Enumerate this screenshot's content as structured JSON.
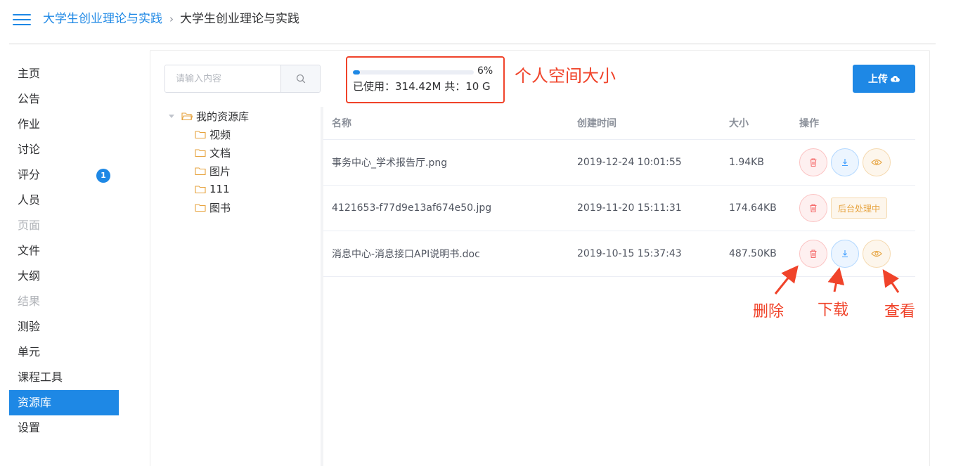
{
  "header": {
    "breadcrumb_link": "大学生创业理论与实践",
    "breadcrumb_separator": "›",
    "breadcrumb_current": "大学生创业理论与实践"
  },
  "sidebar": {
    "items": [
      {
        "label": "主页",
        "state": "normal"
      },
      {
        "label": "公告",
        "state": "normal"
      },
      {
        "label": "作业",
        "state": "normal"
      },
      {
        "label": "讨论",
        "state": "normal"
      },
      {
        "label": "评分",
        "state": "normal",
        "badge": "1"
      },
      {
        "label": "人员",
        "state": "normal"
      },
      {
        "label": "页面",
        "state": "disabled"
      },
      {
        "label": "文件",
        "state": "normal"
      },
      {
        "label": "大纲",
        "state": "normal"
      },
      {
        "label": "结果",
        "state": "disabled"
      },
      {
        "label": "测验",
        "state": "normal"
      },
      {
        "label": "单元",
        "state": "normal"
      },
      {
        "label": "课程工具",
        "state": "normal"
      },
      {
        "label": "资源库",
        "state": "active"
      },
      {
        "label": "设置",
        "state": "normal"
      }
    ]
  },
  "search": {
    "placeholder": "请输入内容",
    "icon": "search-icon"
  },
  "storage": {
    "percent_label": "6%",
    "percent_value": 6,
    "usage_text": "已使用：314.42M 共：10 G",
    "annotation": "个人空间大小"
  },
  "upload": {
    "label": "上传",
    "icon": "cloud-upload-icon"
  },
  "tree": {
    "root": "我的资源库",
    "children": [
      "视频",
      "文档",
      "图片",
      "111",
      "图书"
    ]
  },
  "table": {
    "columns": [
      "名称",
      "创建时间",
      "大小",
      "操作"
    ],
    "rows": [
      {
        "name": "事务中心_学术报告厅.png",
        "created": "2019-12-24 10:01:55",
        "size": "1.94KB",
        "status": ""
      },
      {
        "name": "4121653-f77d9e13af674e50.jpg",
        "created": "2019-11-20 15:11:31",
        "size": "174.64KB",
        "status": "后台处理中"
      },
      {
        "name": "消息中心-消息接口API说明书.doc",
        "created": "2019-10-15 15:37:43",
        "size": "487.50KB",
        "status": ""
      }
    ]
  },
  "annotations": {
    "delete": "删除",
    "download": "下载",
    "view": "查看"
  },
  "colors": {
    "accent": "#1e88e5",
    "annotation_red": "#f0432a",
    "delete_red": "#f56c6c",
    "warning_orange": "#e6a23c"
  }
}
